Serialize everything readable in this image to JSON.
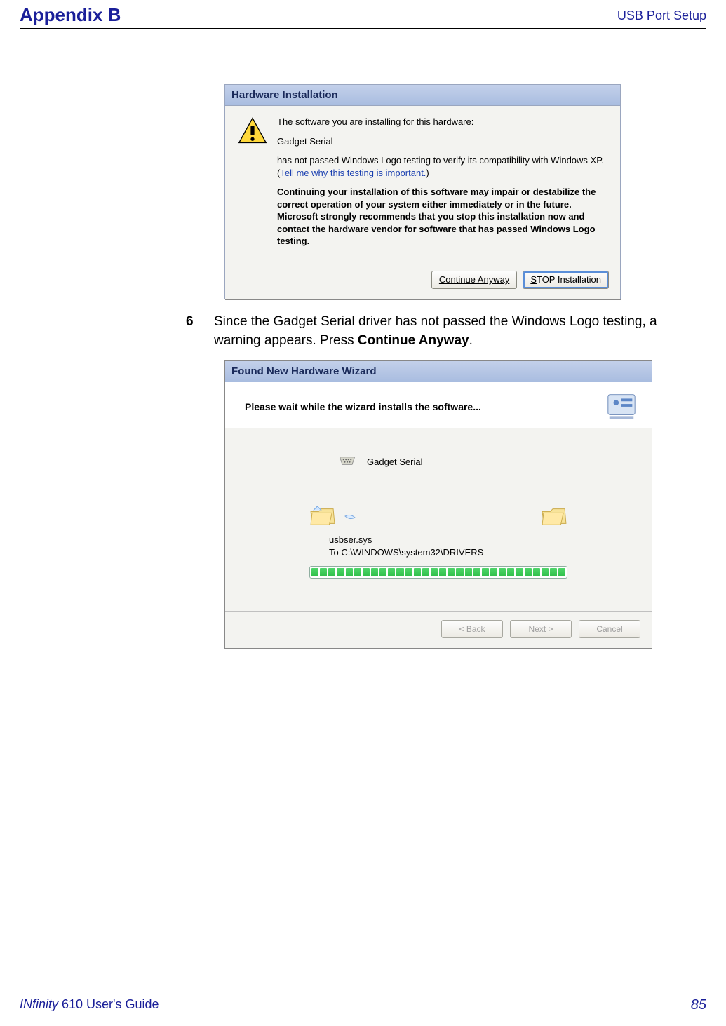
{
  "header": {
    "left": "Appendix B",
    "right": "USB Port Setup"
  },
  "footer": {
    "left_italic": "INfinity",
    "left_rest": " 610 User's Guide",
    "page": "85"
  },
  "dialog1": {
    "title": "Hardware Installation",
    "line_intro": "The software you are installing for this hardware:",
    "device": "Gadget Serial",
    "line_compat_a": "has not passed Windows Logo testing to verify its compatibility with Windows XP. (",
    "link": "Tell me why this testing is important.",
    "line_compat_b": ")",
    "bold_warning": "Continuing your installation of this software may impair or destabilize the correct operation of your system either immediately or in the future. Microsoft strongly recommends that you stop this installation now and contact the hardware vendor for software that has passed Windows Logo testing.",
    "btn_continue": "Continue Anyway",
    "btn_stop_pre": "S",
    "btn_stop_rest": "TOP Installation"
  },
  "step6": {
    "num": "6",
    "text_a": "Since the Gadget Serial driver has not passed the Windows Logo testing, a warning appears. Press ",
    "text_bold": "Continue Anyway",
    "text_b": "."
  },
  "wizard": {
    "title": "Found New Hardware Wizard",
    "heading": "Please wait while the wizard installs the software...",
    "device": "Gadget Serial",
    "file": "usbser.sys",
    "dest": "To C:\\WINDOWS\\system32\\DRIVERS",
    "btn_back_pre": "< ",
    "btn_back_ul": "B",
    "btn_back_rest": "ack",
    "btn_next_ul": "N",
    "btn_next_rest": "ext >",
    "btn_cancel": "Cancel"
  }
}
